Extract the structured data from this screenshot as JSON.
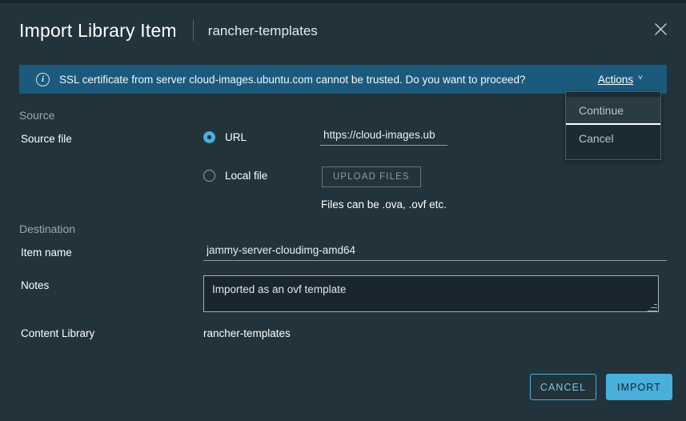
{
  "window": {
    "title": "Import Library Item",
    "subtitle": "rancher-templates",
    "close_icon": "close-icon"
  },
  "alert": {
    "icon": "info-circle-icon",
    "message": "SSL certificate from server cloud-images.ubuntu.com cannot be trusted. Do you want to proceed?",
    "actions_label": "Actions",
    "chevron": "˅"
  },
  "dropdown": {
    "items": [
      {
        "label": "Continue",
        "active": true
      },
      {
        "label": "Cancel",
        "active": false
      }
    ]
  },
  "source": {
    "section_label": "Source",
    "field_label": "Source file",
    "url_option": "URL",
    "url_value": "https://cloud-images.ub",
    "url_placeholder": "",
    "local_option": "Local file",
    "upload_button": "UPLOAD FILES",
    "hint": "Files can be .ova, .ovf etc."
  },
  "destination": {
    "section_label": "Destination",
    "item_name_label": "Item name",
    "item_name_value": "jammy-server-cloudimg-amd64",
    "item_name_placeholder": "",
    "notes_label": "Notes",
    "notes_value": "Imported as an ovf template",
    "notes_placeholder": "",
    "content_library_label": "Content Library",
    "content_library_value": "rancher-templates"
  },
  "footer": {
    "cancel_label": "CANCEL",
    "import_label": "IMPORT"
  },
  "colors": {
    "background": "#22333b",
    "accent": "#49afdb",
    "alert_background": "#1c5a7d",
    "dropdown_background": "#1b2b33",
    "text": "#ffffff"
  }
}
